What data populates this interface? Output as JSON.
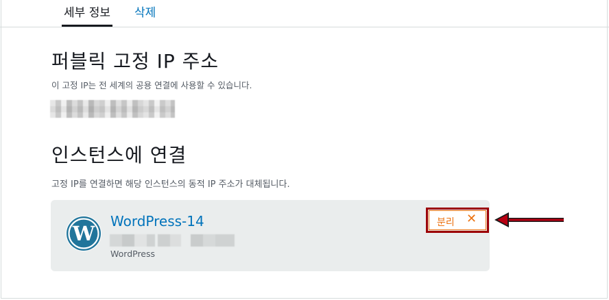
{
  "tabs": [
    {
      "label": "세부 정보",
      "active": true
    },
    {
      "label": "삭제",
      "active": false
    }
  ],
  "static_ip": {
    "title": "퍼블릭 고정 IP 주소",
    "description": "이 고정 IP는 전 세계의 공용 연결에 사용할 수 있습니다."
  },
  "attach": {
    "title": "인스턴스에 연결",
    "description": "고정 IP를 연결하면 해당 인스턴스의 동적 IP 주소가 대체됩니다.",
    "instance": {
      "name": "WordPress-14",
      "type": "WordPress",
      "logo_icon": "wordpress-logo-icon"
    },
    "detach": {
      "label": "분리",
      "icon_glyph": "✕"
    }
  },
  "colors": {
    "link": "#0073bb",
    "accent": "#ec7211",
    "highlight_border": "#9c0006",
    "card_bg": "#eaeded"
  }
}
